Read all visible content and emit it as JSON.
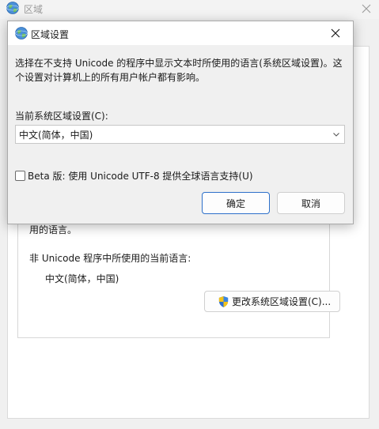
{
  "background_window": {
    "title": "区域",
    "partial_text": "用的语言。",
    "current_language_label": "非 Unicode 程序中所使用的当前语言:",
    "current_language_value": "中文(简体，中国)",
    "change_locale_button": "更改系统区域设置(C)..."
  },
  "dialog": {
    "title": "区域设置",
    "description": "选择在不支持 Unicode 的程序中显示文本时所使用的语言(系统区域设置)。这个设置对计算机上的所有用户帐户都有影响。",
    "locale_label": "当前系统区域设置(C):",
    "locale_value": "中文(简体，中国)",
    "beta_checkbox_label": "Beta 版: 使用 Unicode UTF-8 提供全球语言支持(U)",
    "beta_checked": false,
    "ok_label": "确定",
    "cancel_label": "取消"
  },
  "colors": {
    "accent": "#2c6fc9",
    "dialog_bg": "#f0f0f0"
  },
  "icons": {
    "app": "globe-icon",
    "close": "close-icon",
    "dropdown": "chevron-down-icon",
    "uac": "shield-icon"
  }
}
